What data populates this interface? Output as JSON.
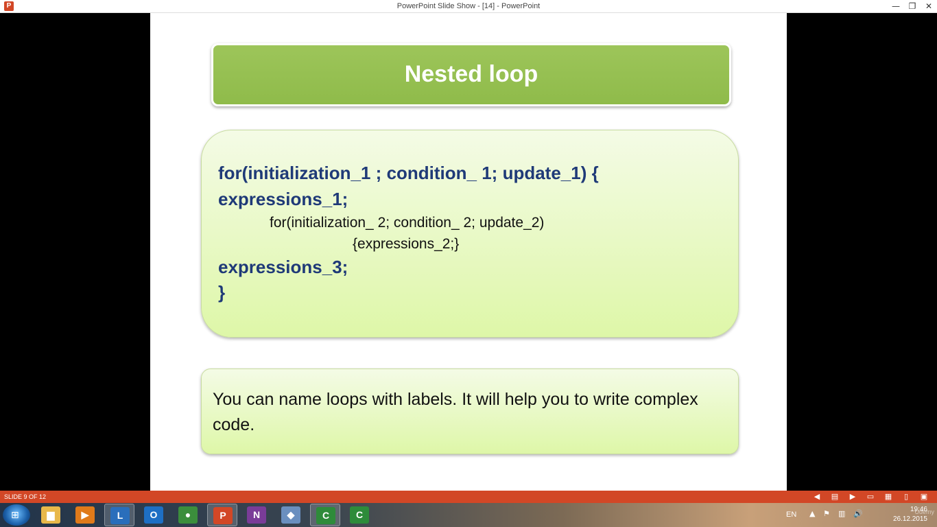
{
  "window": {
    "title": "PowerPoint Slide Show - [14] - PowerPoint",
    "app_icon": "powerpoint-icon",
    "app_icon_glyph": "P",
    "controls": [
      "minimize-icon",
      "restore-icon",
      "close-icon"
    ],
    "control_glyphs": [
      "—",
      "❐",
      "✕"
    ]
  },
  "slide": {
    "title": "Nested loop",
    "code_lines": [
      "for(initialization_1 ; condition_ 1; update_1)  {",
      "expressions_1;",
      "for(initialization_ 2; condition_ 2; update_2)",
      "{expressions_2;}",
      "expressions_3;",
      "}"
    ],
    "note": "You can name loops with labels. It will help you to write complex code."
  },
  "status_bar": {
    "slide_counter": "SLIDE 9 OF 12",
    "controls": [
      "previous-icon",
      "slide-grid-icon",
      "next-icon",
      "normal-view-icon",
      "slide-sorter-icon",
      "reading-view-icon",
      "slideshow-icon"
    ],
    "control_glyphs": [
      "◀",
      "▤",
      "▶",
      "▭",
      "▦",
      "▯",
      "▣"
    ]
  },
  "taskbar": {
    "apps": [
      {
        "icon": "folder-icon",
        "glyph": "▆",
        "color": "#e8b84a",
        "active": false
      },
      {
        "icon": "media-player-icon",
        "glyph": "▶",
        "color": "#e07a1a",
        "active": false
      },
      {
        "icon": "lync-icon",
        "glyph": "L",
        "color": "#2a6ebb",
        "active": true
      },
      {
        "icon": "outlook-icon",
        "glyph": "O",
        "color": "#1e6fc4",
        "active": false
      },
      {
        "icon": "chrome-icon",
        "glyph": "●",
        "color": "#3b8e3c",
        "active": false
      },
      {
        "icon": "powerpoint-icon",
        "glyph": "P",
        "color": "#d24726",
        "active": true
      },
      {
        "icon": "onenote-icon",
        "glyph": "N",
        "color": "#7a3c98",
        "active": false
      },
      {
        "icon": "box-app-icon",
        "glyph": "◆",
        "color": "#6a8fbf",
        "active": false
      },
      {
        "icon": "camtasia-icon",
        "glyph": "C",
        "color": "#2e8b3a",
        "active": true
      },
      {
        "icon": "camtasia-recorder-icon",
        "glyph": "C",
        "color": "#2e8b3a",
        "active": false
      }
    ],
    "tray": {
      "language": "EN",
      "icons": [
        "show-hidden-icon",
        "flag-icon",
        "network-icon",
        "speaker-icon"
      ],
      "icon_glyphs": [
        "▲",
        "⚑",
        "▥",
        "🔊"
      ],
      "time": "19:46",
      "date": "26.12.2015",
      "watermark": "Udemy"
    }
  },
  "colors": {
    "accent": "#d24726",
    "title_box": "#9dc55a",
    "code_text": "#1f3a78",
    "box_fill": "#def7a8"
  }
}
